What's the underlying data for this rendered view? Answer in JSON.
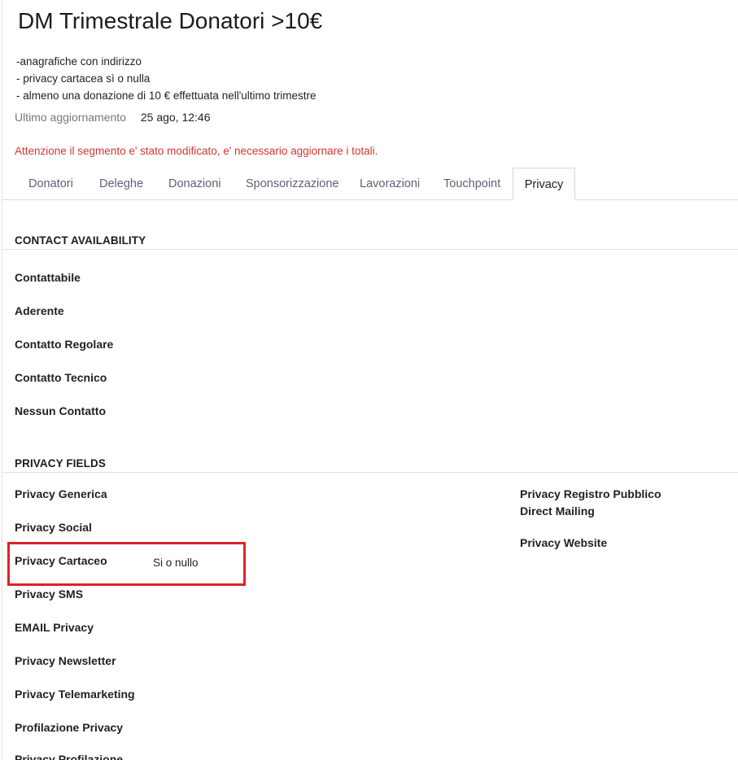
{
  "header": {
    "title": "DM Trimestrale Donatori >10€",
    "description": [
      "-anagrafiche con indirizzo",
      "- privacy cartacea sì o nulla",
      "- almeno una donazione di 10 € effettuata nell'ultimo trimestre"
    ],
    "last_update_label": "Ultimo aggiornamento",
    "last_update_value": "25 ago, 12:46",
    "warning": "Attenzione il segmento e' stato modificato, e' necessario aggiornare i totali."
  },
  "tabs": [
    {
      "label": "Donatori",
      "active": false
    },
    {
      "label": "Deleghe",
      "active": false
    },
    {
      "label": "Donazioni",
      "active": false
    },
    {
      "label": "Sponsorizzazione",
      "active": false
    },
    {
      "label": "Lavorazioni",
      "active": false
    },
    {
      "label": "Touchpoint",
      "active": false
    },
    {
      "label": "Privacy",
      "active": true
    }
  ],
  "contact_availability": {
    "heading": "CONTACT AVAILABILITY",
    "fields": [
      "Contattabile",
      "Aderente",
      "Contatto Regolare",
      "Contatto Tecnico",
      "Nessun Contatto"
    ]
  },
  "privacy_fields": {
    "heading": "PRIVACY FIELDS",
    "left": [
      {
        "label": "Privacy Generica",
        "value": ""
      },
      {
        "label": "Privacy Social",
        "value": ""
      },
      {
        "label": "Privacy Cartaceo",
        "value": "Si o nullo"
      },
      {
        "label": "Privacy SMS",
        "value": ""
      },
      {
        "label": "EMAIL Privacy",
        "value": ""
      },
      {
        "label": "Privacy Newsletter",
        "value": ""
      },
      {
        "label": "Privacy Telemarketing",
        "value": ""
      },
      {
        "label": "Profilazione Privacy",
        "value": ""
      },
      {
        "label": "Privacy Profilazione",
        "value": ""
      }
    ],
    "right": [
      {
        "label": "Privacy Registro Pubblico Direct Mailing",
        "value": ""
      },
      {
        "label": "Privacy Website",
        "value": ""
      }
    ]
  },
  "colors": {
    "warning": "#d2372f",
    "highlight": "#e0202a",
    "tab_text": "#5f5f77"
  }
}
